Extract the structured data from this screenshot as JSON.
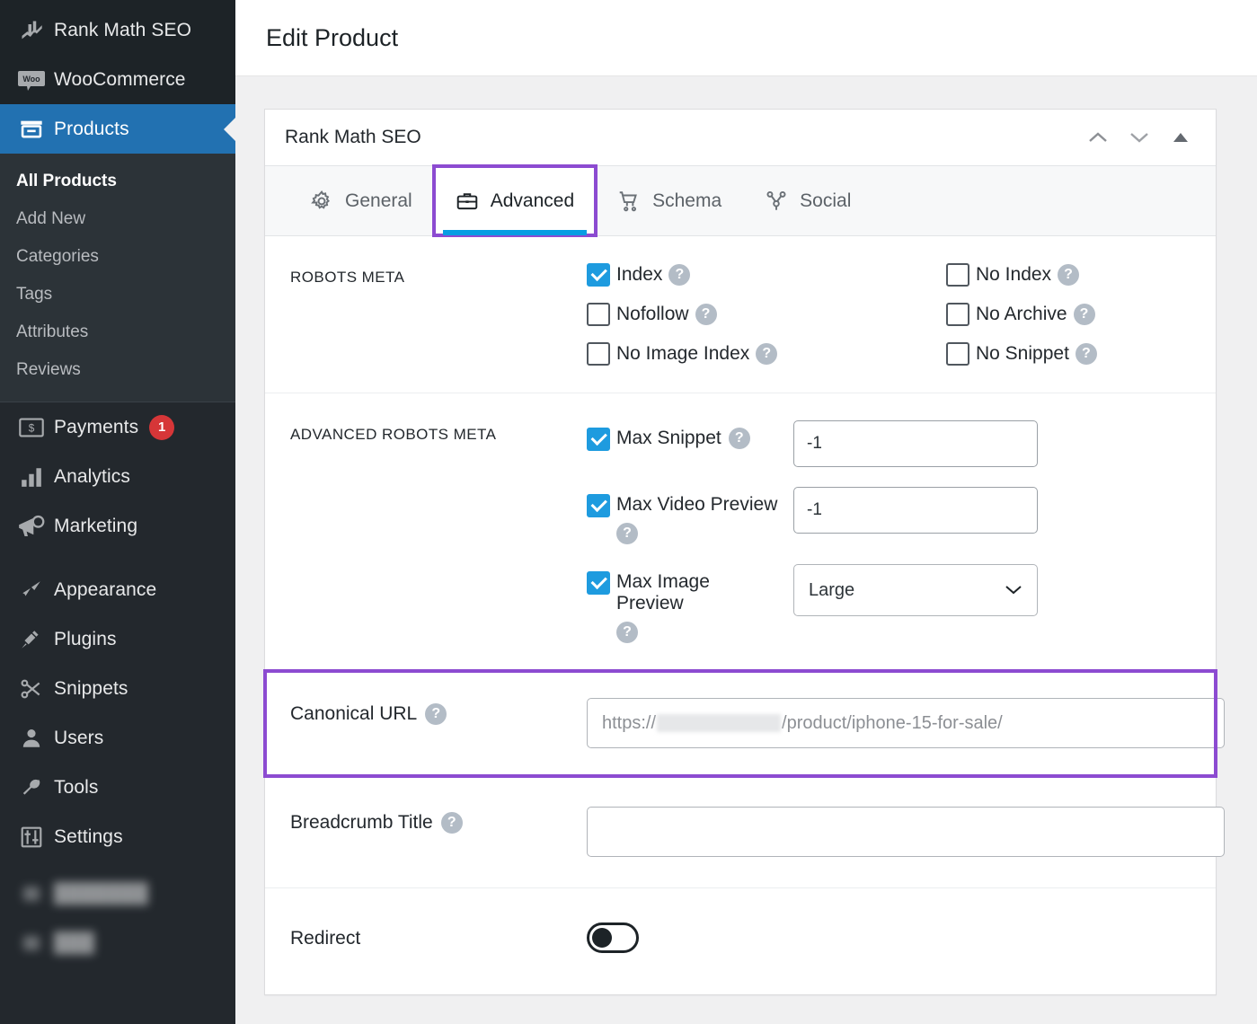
{
  "sidebar": {
    "top_items": [
      {
        "label": "Rank Math SEO",
        "icon": "rank-math-logo-icon"
      },
      {
        "label": "WooCommerce",
        "icon": "woocommerce-icon"
      }
    ],
    "active_item": {
      "label": "Products",
      "icon": "products-box-icon"
    },
    "sub_items": [
      {
        "label": "All Products",
        "current": true
      },
      {
        "label": "Add New",
        "current": false
      },
      {
        "label": "Categories",
        "current": false
      },
      {
        "label": "Tags",
        "current": false
      },
      {
        "label": "Attributes",
        "current": false
      },
      {
        "label": "Reviews",
        "current": false
      }
    ],
    "group_two": [
      {
        "label": "Payments",
        "icon": "payments-icon",
        "badge": "1"
      },
      {
        "label": "Analytics",
        "icon": "analytics-bars-icon",
        "badge": ""
      },
      {
        "label": "Marketing",
        "icon": "megaphone-icon",
        "badge": ""
      }
    ],
    "group_three": [
      {
        "label": "Appearance",
        "icon": "paintbrush-icon"
      },
      {
        "label": "Plugins",
        "icon": "plug-icon"
      },
      {
        "label": "Snippets",
        "icon": "scissors-icon"
      },
      {
        "label": "Users",
        "icon": "user-icon"
      },
      {
        "label": "Tools",
        "icon": "wrench-icon"
      },
      {
        "label": "Settings",
        "icon": "sliders-icon"
      }
    ]
  },
  "header": {
    "title": "Edit Product"
  },
  "panel": {
    "title": "Rank Math SEO",
    "controls": [
      {
        "name": "move-up-button",
        "icon": "chevron-up-icon"
      },
      {
        "name": "move-down-button",
        "icon": "chevron-down-icon"
      },
      {
        "name": "collapse-panel-button",
        "icon": "triangle-up-icon"
      }
    ],
    "tabs": [
      {
        "label": "General",
        "icon": "gear-icon",
        "active": false
      },
      {
        "label": "Advanced",
        "icon": "briefcase-icon",
        "active": true,
        "highlighted": true
      },
      {
        "label": "Schema",
        "icon": "shopping-cart-icon",
        "active": false
      },
      {
        "label": "Social",
        "icon": "share-nodes-icon",
        "active": false
      }
    ]
  },
  "robots_meta": {
    "label": "ROBOTS META",
    "options": [
      {
        "label": "Index",
        "checked": true
      },
      {
        "label": "No Index",
        "checked": false
      },
      {
        "label": "Nofollow",
        "checked": false
      },
      {
        "label": "No Archive",
        "checked": false
      },
      {
        "label": "No Image Index",
        "checked": false
      },
      {
        "label": "No Snippet",
        "checked": false
      }
    ]
  },
  "advanced_robots_meta": {
    "label": "ADVANCED ROBOTS META",
    "items": [
      {
        "label": "Max Snippet",
        "checked": true,
        "control": "input",
        "value": "-1"
      },
      {
        "label": "Max Video Preview",
        "checked": true,
        "control": "input",
        "value": "-1"
      },
      {
        "label": "Max Image Preview",
        "checked": true,
        "control": "select",
        "value": "Large"
      }
    ]
  },
  "canonical_url": {
    "label": "Canonical URL",
    "placeholder_prefix": "https://",
    "placeholder_suffix": "/product/iphone-15-for-sale/",
    "value": "",
    "highlighted": true
  },
  "breadcrumb_title": {
    "label": "Breadcrumb Title",
    "value": ""
  },
  "redirect": {
    "label": "Redirect",
    "enabled": false
  },
  "colors": {
    "sidebar_bg": "#23282d",
    "sidebar_top_bg": "#1d2327",
    "sidebar_sub_bg": "#2c3338",
    "active_blue": "#2271b1",
    "accent_blue": "#069de3",
    "checkbox_blue": "#1e9bdf",
    "highlight_purple": "#8c4bd1",
    "badge_red": "#d63638",
    "help_gray": "#b3bcc6",
    "page_bg": "#f0f0f1"
  }
}
